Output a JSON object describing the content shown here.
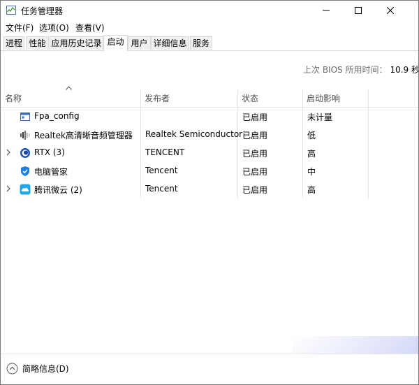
{
  "window": {
    "title": "任务管理器"
  },
  "menu": {
    "items": [
      "文件(F)",
      "选项(O)",
      "查看(V)"
    ]
  },
  "tabs": [
    "进程",
    "性能",
    "应用历史记录",
    "启动",
    "用户",
    "详细信息",
    "服务"
  ],
  "active_tab": "启动",
  "bios": {
    "label": "上次 BIOS 所用时间：",
    "value": "10.9 秒"
  },
  "columns": {
    "name": "名称",
    "publisher": "发布者",
    "status": "状态",
    "impact": "启动影响"
  },
  "rows": [
    {
      "name": "Fpa_config",
      "publisher": "",
      "status": "已启用",
      "impact": "未计量",
      "icon": "app-window-icon",
      "expandable": false
    },
    {
      "name": "Realtek高清晰音频管理器",
      "publisher": "Realtek Semiconductor",
      "status": "已启用",
      "impact": "低",
      "icon": "speaker-icon",
      "expandable": false
    },
    {
      "name": "RTX (3)",
      "publisher": "TENCENT",
      "status": "已启用",
      "impact": "高",
      "icon": "rtx-icon",
      "expandable": true
    },
    {
      "name": "电脑管家",
      "publisher": "Tencent",
      "status": "已启用",
      "impact": "中",
      "icon": "shield-icon",
      "expandable": false
    },
    {
      "name": "腾讯微云 (2)",
      "publisher": "Tencent",
      "status": "已启用",
      "impact": "高",
      "icon": "cloud-icon",
      "expandable": true
    }
  ],
  "footer": {
    "fewer_details": "简略信息(D)"
  },
  "colors": {
    "accent": "#1979ca",
    "header_text": "#4c4c4c",
    "bios_label": "#6d6d6d",
    "grid": "#e5e5e5"
  }
}
